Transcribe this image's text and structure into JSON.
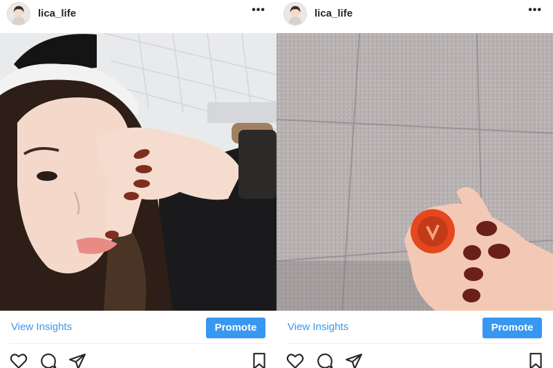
{
  "posts": [
    {
      "username": "lica_life",
      "more_label": "•••",
      "photo_icon": "selfie-photo",
      "insights_label": "View Insights",
      "promote_label": "Promote"
    },
    {
      "username": "lica_life",
      "more_label": "•••",
      "photo_icon": "hand-ring-photo",
      "insights_label": "View Insights",
      "promote_label": "Promote"
    }
  ],
  "icons": {
    "like": "heart-icon",
    "comment": "comment-icon",
    "share": "share-icon",
    "save": "bookmark-icon"
  },
  "colors": {
    "accent": "#3897f0",
    "text": "#262626",
    "divider": "#efefef"
  }
}
